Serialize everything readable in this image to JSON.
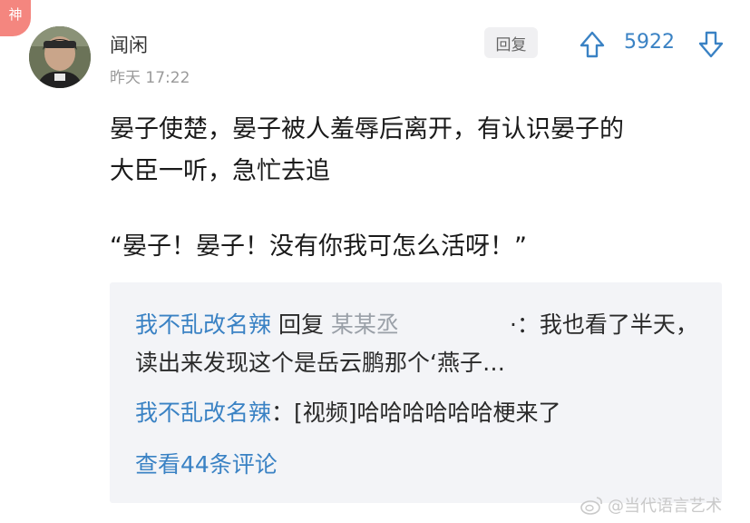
{
  "badge": "神",
  "comment": {
    "username": "闻闲",
    "timestamp": "昨天 17:22",
    "reply_label": "回复",
    "upvotes": "5922",
    "body_lines": [
      "晏子使楚，晏子被人羞辱后离开，有认识晏子的",
      "大臣一听，急忙去追"
    ],
    "quote": "“晏子！晏子！没有你我可怎么活呀！”"
  },
  "replies": [
    {
      "author": "我不乱改名辣",
      "reply_word": " 回复 ",
      "target": "某某丞",
      "text": "·：我也看了半天，读出来发现这个是岳云鹏那个‘燕子…"
    },
    {
      "author": "我不乱改名辣",
      "text": "：[视频]哈哈哈哈哈哈梗来了"
    }
  ],
  "more_comments": "查看44条评论",
  "watermark": "@当代语言艺术",
  "colors": {
    "accent": "#3a82c4",
    "badge": "#f4867f",
    "reply_bg": "#f3f4f7"
  },
  "icons": [
    "upvote-arrow-icon",
    "downvote-arrow-icon",
    "weibo-logo-icon"
  ]
}
